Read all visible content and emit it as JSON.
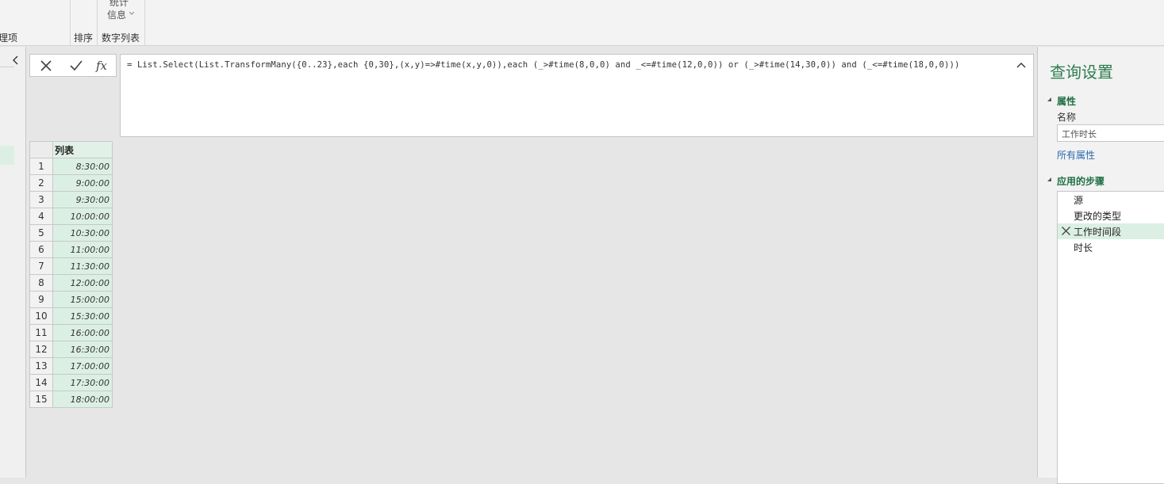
{
  "ribbon": {
    "truncated_label_left": "理项",
    "sort_group_label": "排序",
    "numlist_group_label": "数字列表",
    "stats_button_line1": "统计",
    "stats_button_line2": "信息"
  },
  "formula_bar": {
    "cancel_icon": "x-icon",
    "confirm_icon": "check-icon",
    "fx_icon": "fx-icon",
    "fx_label": "fx",
    "formula": "= List.Select(List.TransformMany({0..23},each {0,30},(x,y)=>#time(x,y,0)),each (_>#time(8,0,0) and _<=#time(12,0,0)) or (_>#time(14,30,0)) and (_<=#time(18,0,0)))"
  },
  "grid": {
    "column_header": "列表",
    "rows": [
      {
        "num": "1",
        "value": "8:30:00"
      },
      {
        "num": "2",
        "value": "9:00:00"
      },
      {
        "num": "3",
        "value": "9:30:00"
      },
      {
        "num": "4",
        "value": "10:00:00"
      },
      {
        "num": "5",
        "value": "10:30:00"
      },
      {
        "num": "6",
        "value": "11:00:00"
      },
      {
        "num": "7",
        "value": "11:30:00"
      },
      {
        "num": "8",
        "value": "12:00:00"
      },
      {
        "num": "9",
        "value": "15:00:00"
      },
      {
        "num": "10",
        "value": "15:30:00"
      },
      {
        "num": "11",
        "value": "16:00:00"
      },
      {
        "num": "12",
        "value": "16:30:00"
      },
      {
        "num": "13",
        "value": "17:00:00"
      },
      {
        "num": "14",
        "value": "17:30:00"
      },
      {
        "num": "15",
        "value": "18:00:00"
      }
    ]
  },
  "query_settings": {
    "title": "查询设置",
    "properties_head": "属性",
    "name_label": "名称",
    "name_value": "工作时长",
    "all_properties_link": "所有属性",
    "applied_steps_head": "应用的步骤",
    "steps": [
      {
        "label": "源",
        "selected": false
      },
      {
        "label": "更改的类型",
        "selected": false
      },
      {
        "label": "工作时间段",
        "selected": true
      },
      {
        "label": "时长",
        "selected": false
      }
    ]
  },
  "colors": {
    "accent_green": "#2d7d4f",
    "selected_bg": "#dcefe4",
    "link_blue": "#2a6ab0"
  }
}
